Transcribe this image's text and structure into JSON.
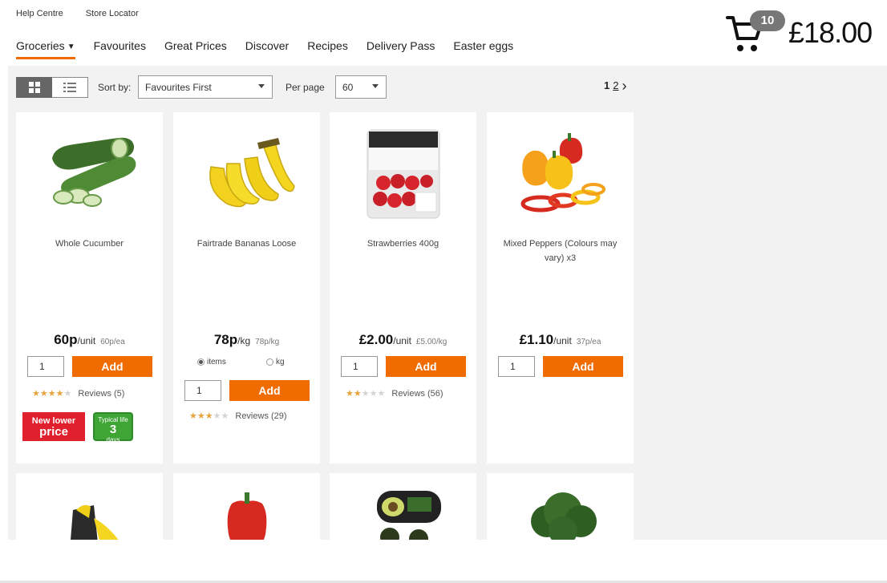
{
  "top_links": {
    "help": "Help Centre",
    "store": "Store Locator"
  },
  "nav": [
    {
      "label": "Groceries"
    },
    {
      "label": "Favourites"
    },
    {
      "label": "Great Prices"
    },
    {
      "label": "Discover"
    },
    {
      "label": "Recipes"
    },
    {
      "label": "Delivery Pass"
    },
    {
      "label": "Easter eggs"
    }
  ],
  "cart": {
    "count": "10",
    "total": "£18.00"
  },
  "toolbar": {
    "sort_label": "Sort by:",
    "sort_value": "Favourites First",
    "perpage_label": "Per page",
    "perpage_value": "60",
    "page_current": "1",
    "page_next": "2"
  },
  "products": [
    {
      "name": "Whole Cucumber",
      "price": "60p",
      "unit": "/unit",
      "per": "60p/ea",
      "qty": "1",
      "add": "Add",
      "stars": 4,
      "reviews": "Reviews (5)",
      "promo": {
        "line1": "New lower",
        "line2": "price"
      },
      "shelf": {
        "line1": "Typical life",
        "num": "3",
        "line2": "days"
      }
    },
    {
      "name": "Fairtrade Bananas Loose",
      "price": "78p",
      "unit": "/kg",
      "per": "78p/kg",
      "options": {
        "items": "items",
        "kg": "kg"
      },
      "qty": "1",
      "add": "Add",
      "stars": 3,
      "reviews": "Reviews (29)"
    },
    {
      "name": "Strawberries 400g",
      "price": "£2.00",
      "unit": "/unit",
      "per": "£5.00/kg",
      "qty": "1",
      "add": "Add",
      "stars": 2,
      "reviews": "Reviews (56)"
    },
    {
      "name": "Mixed Peppers (Colours may vary) x3",
      "price": "£1.10",
      "unit": "/unit",
      "per": "37p/ea",
      "qty": "1",
      "add": "Add"
    }
  ],
  "colors": {
    "accent": "#f06c00",
    "promo_red": "#e0212d",
    "shelf_green": "#3fa535",
    "star": "#e8a33c"
  }
}
